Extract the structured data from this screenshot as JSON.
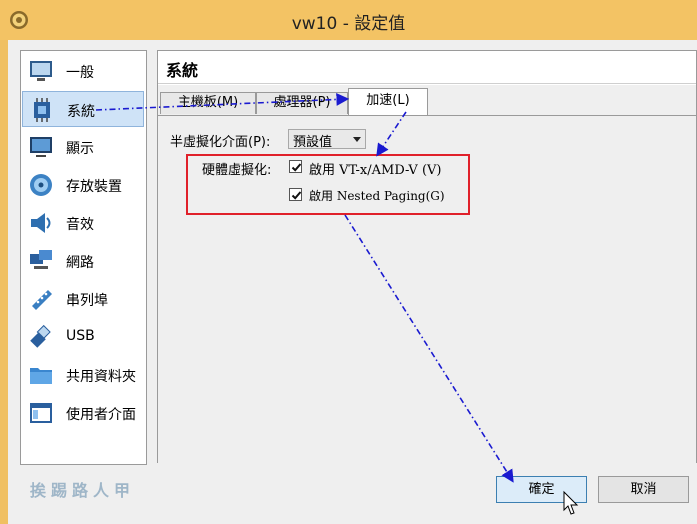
{
  "window": {
    "title": "vw10 - 設定值"
  },
  "sidebar": {
    "items": [
      {
        "label": "一般",
        "icon": "monitor-icon"
      },
      {
        "label": "系統",
        "icon": "chip-icon",
        "selected": true
      },
      {
        "label": "顯示",
        "icon": "display-icon"
      },
      {
        "label": "存放裝置",
        "icon": "disk-icon"
      },
      {
        "label": "音效",
        "icon": "speaker-icon"
      },
      {
        "label": "網路",
        "icon": "network-icon"
      },
      {
        "label": "串列埠",
        "icon": "serial-port-icon"
      },
      {
        "label": "USB",
        "icon": "usb-icon"
      },
      {
        "label": "共用資料夾",
        "icon": "folder-icon"
      },
      {
        "label": "使用者介面",
        "icon": "user-interface-icon"
      }
    ]
  },
  "panel": {
    "title": "系統",
    "tabs": [
      {
        "label": "主機板(M)"
      },
      {
        "label": "處理器(P)"
      },
      {
        "label": "加速(L)",
        "active": true
      }
    ],
    "paravirt": {
      "label": "半虛擬化介面(P):",
      "value": "預設值"
    },
    "hwvirt": {
      "label": "硬體虛擬化:",
      "vtx": {
        "label": "啟用 VT-x/AMD-V (V)",
        "checked": true
      },
      "nested": {
        "label": "啟用 Nested Paging(G)",
        "checked": true
      }
    }
  },
  "buttons": {
    "ok": "確定",
    "cancel": "取消"
  },
  "watermark": "挨踢路人甲",
  "colors": {
    "annotation_box": "#e0202a",
    "annotation_arrow": "#1a1ad0",
    "selection": "#cfe3f7"
  }
}
